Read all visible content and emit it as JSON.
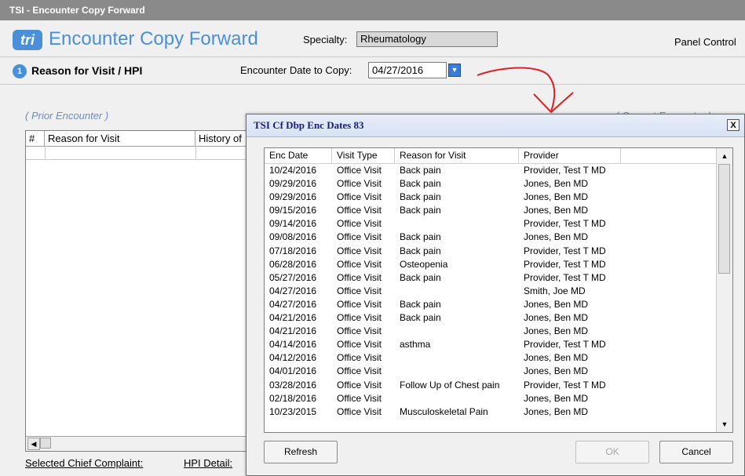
{
  "window": {
    "title": "TSI - Encounter Copy Forward"
  },
  "header": {
    "logo_text": "tri",
    "app_title": "Encounter Copy Forward",
    "specialty_label": "Specialty:",
    "specialty_value": "Rheumatology",
    "panel_control": "Panel Control"
  },
  "section": {
    "step_number": "1",
    "title": "Reason for Visit / HPI",
    "date_label": "Encounter Date to Copy:",
    "date_value": "04/27/2016",
    "prior_encounter": "( Prior Encounter )",
    "current_encounter": "( Current Encounter )"
  },
  "left_table": {
    "columns": [
      "#",
      "Reason for Visit",
      "History of"
    ]
  },
  "bottom": {
    "selected_chief_complaint": "Selected Chief Complaint:",
    "hpi_detail": "HPI Detail:"
  },
  "dialog": {
    "title": "TSI Cf Dbp Enc Dates 83",
    "close_glyph": "X",
    "columns": [
      "Enc Date",
      "Visit Type",
      "Reason for Visit",
      "Provider"
    ],
    "rows": [
      [
        "10/24/2016",
        "Office Visit",
        "Back pain",
        "Provider, Test T MD"
      ],
      [
        "09/29/2016",
        "Office Visit",
        "Back pain",
        "Jones, Ben MD"
      ],
      [
        "09/29/2016",
        "Office Visit",
        "Back pain",
        "Jones, Ben MD"
      ],
      [
        "09/15/2016",
        "Office Visit",
        "Back pain",
        "Jones, Ben MD"
      ],
      [
        "09/14/2016",
        "Office Visit",
        "",
        "Provider, Test T MD"
      ],
      [
        "09/08/2016",
        "Office Visit",
        "Back pain",
        "Jones, Ben MD"
      ],
      [
        "07/18/2016",
        "Office Visit",
        "Back pain",
        "Provider, Test T MD"
      ],
      [
        "06/28/2016",
        "Office Visit",
        "Osteopenia",
        "Provider, Test T MD"
      ],
      [
        "05/27/2016",
        "Office Visit",
        "Back pain",
        "Provider, Test T MD"
      ],
      [
        "04/27/2016",
        "Office Visit",
        "",
        "Smith, Joe MD"
      ],
      [
        "04/27/2016",
        "Office Visit",
        "Back pain",
        "Jones, Ben MD"
      ],
      [
        "04/21/2016",
        "Office Visit",
        "Back pain",
        "Jones, Ben MD"
      ],
      [
        "04/21/2016",
        "Office Visit",
        "",
        "Jones, Ben MD"
      ],
      [
        "04/14/2016",
        "Office Visit",
        "asthma",
        "Provider, Test T MD"
      ],
      [
        "04/12/2016",
        "Office Visit",
        "",
        "Jones, Ben MD"
      ],
      [
        "04/01/2016",
        "Office Visit",
        "",
        "Jones, Ben MD"
      ],
      [
        "03/28/2016",
        "Office Visit",
        "Follow Up of Chest pain",
        "Provider, Test T MD"
      ],
      [
        "02/18/2016",
        "Office Visit",
        "",
        "Jones, Ben MD"
      ],
      [
        "10/23/2015",
        "Office Visit",
        "Musculoskeletal Pain",
        "Jones, Ben MD"
      ]
    ],
    "buttons": {
      "refresh": "Refresh",
      "ok": "OK",
      "cancel": "Cancel"
    }
  },
  "colors": {
    "accent": "#4a90d9",
    "annotation": "#e02020",
    "titlebar": "#8a8a8a"
  }
}
